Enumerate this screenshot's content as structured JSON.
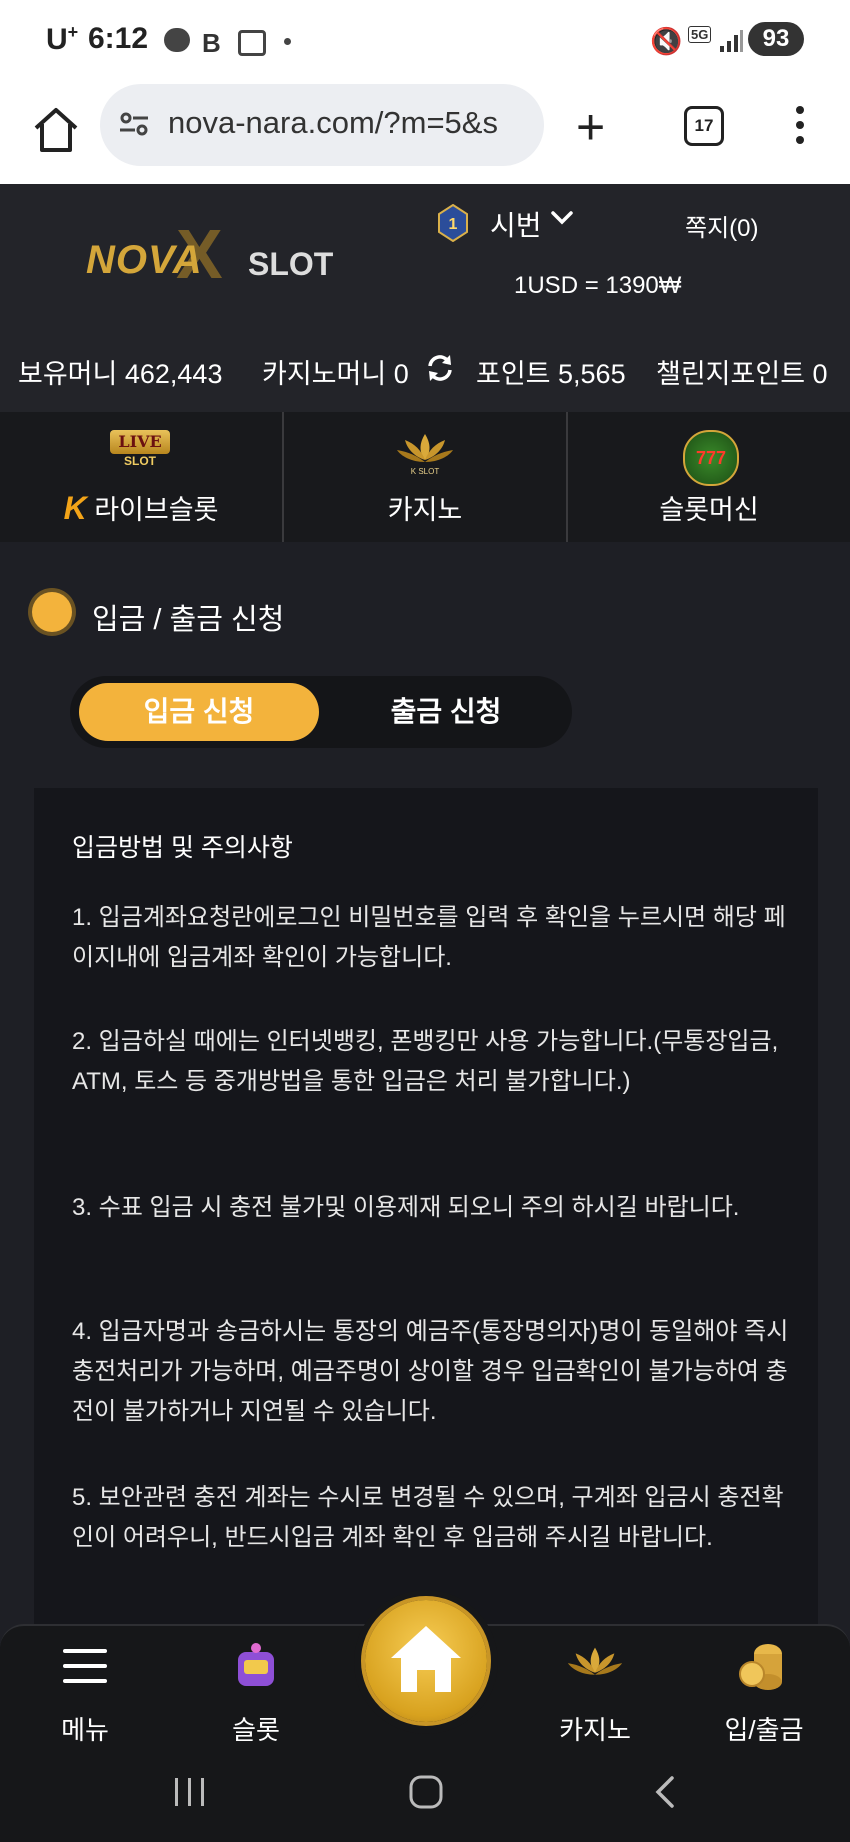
{
  "status_bar": {
    "carrier": "U",
    "carrier_sup": "+",
    "time": "6:12",
    "battery": "93"
  },
  "browser": {
    "url": "nova-nara.com/?m=5&s",
    "tab_count": "17"
  },
  "header": {
    "logo_main": "NOVA",
    "logo_sub": "SLOT",
    "level": "1",
    "username": "시번",
    "messages": "쪽지(0)",
    "exchange_rate": "1USD = 1390₩"
  },
  "balances": {
    "holding": "보유머니 462,443",
    "casino": "카지노머니 0",
    "points": "포인트 5,565",
    "challenge": "챌린지포인트 0"
  },
  "categories": [
    {
      "label": "라이브슬롯",
      "prefix": "K",
      "badge_top": "LIVE",
      "badge_bottom": "SLOT"
    },
    {
      "label": "카지노",
      "badge": "K SLOT"
    },
    {
      "label": "슬롯머신",
      "badge": "777"
    }
  ],
  "section": {
    "title": "입금 / 출금 신청",
    "deposit_tab": "입금 신청",
    "withdraw_tab": "출금 신청"
  },
  "notice": {
    "title": "입금방법 및 주의사항",
    "items": [
      "1. 입금계좌요청란에로그인 비밀번호를 입력 후 확인을 누르시면 해당 페이지내에 입금계좌 확인이 가능합니다.",
      "2. 입금하실 때에는 인터넷뱅킹, 폰뱅킹만 사용 가능합니다.(무통장입금, ATM, 토스 등 중개방법을 통한 입금은 처리 불가합니다.)",
      "3. 수표 입금 시 충전 불가및 이용제재 되오니 주의 하시길 바랍니다.",
      "4. 입금자명과 송금하시는 통장의 예금주(통장명의자)명이 동일해야 즉시 충전처리가 가능하며, 예금주명이 상이할 경우 입금확인이 불가능하여 충전이 불가하거나 지연될 수 있습니다.",
      "5. 보안관련 충전 계좌는 수시로 변경될 수 있으며, 구계좌 입금시 충전확인이 어려우니, 반드시입금 계좌 확인 후 입금해 주시길 바랍니다."
    ]
  },
  "bottom_nav": {
    "menu": "메뉴",
    "slot": "슬롯",
    "casino": "카지노",
    "deposit_withdraw": "입/출금"
  },
  "colors": {
    "accent": "#f3b33c",
    "background": "#1e1f25",
    "header": "#232429",
    "notice_bg": "#15161b"
  }
}
